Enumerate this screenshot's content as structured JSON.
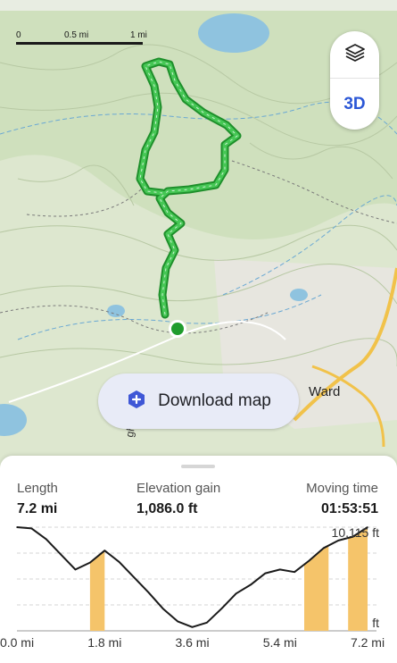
{
  "map": {
    "scale": {
      "ticks": [
        "0",
        "0.5 mi",
        "1 mi"
      ]
    },
    "controls": {
      "layers_icon": "layers-icon",
      "three_d_label": "3D"
    },
    "download_button": {
      "label": "Download map",
      "icon": "download-map-icon"
    },
    "place_label": "Ward",
    "road_label": "gh Tra",
    "colors": {
      "trail": "#2fbb3c",
      "water": "#7fb8d8",
      "terrain": "#c8dcb4",
      "start": "#1f9c2c",
      "elevation_fill": "#f5c46a"
    }
  },
  "stats": {
    "length": {
      "label": "Length",
      "value": "7.2 mi"
    },
    "elevation_gain": {
      "label": "Elevation gain",
      "value": "1,086.0 ft"
    },
    "moving_time": {
      "label": "Moving time",
      "value": "01:53:51"
    }
  },
  "chart_data": {
    "type": "area",
    "title": "",
    "xlabel": "",
    "ylabel": "",
    "x_tick_labels": [
      "0.0 mi",
      "1.8 mi",
      "3.6 mi",
      "5.4 mi",
      "7.2 mi"
    ],
    "y_tick_labels": [
      "10,115 ft",
      "ft"
    ],
    "x": [
      0.0,
      0.3,
      0.6,
      0.9,
      1.2,
      1.5,
      1.8,
      2.1,
      2.4,
      2.7,
      3.0,
      3.3,
      3.6,
      3.9,
      4.2,
      4.5,
      4.8,
      5.1,
      5.4,
      5.7,
      6.0,
      6.3,
      6.6,
      6.9,
      7.2
    ],
    "y": [
      10115,
      10105,
      10020,
      9900,
      9780,
      9835,
      9930,
      9840,
      9720,
      9600,
      9470,
      9370,
      9325,
      9360,
      9470,
      9590,
      9660,
      9750,
      9780,
      9760,
      9850,
      9950,
      10010,
      10040,
      10115
    ],
    "xlim": [
      0,
      7.2
    ],
    "highlight_ranges": [
      [
        1.5,
        1.8
      ],
      [
        5.9,
        6.4
      ],
      [
        6.8,
        7.2
      ]
    ],
    "grid": true
  }
}
